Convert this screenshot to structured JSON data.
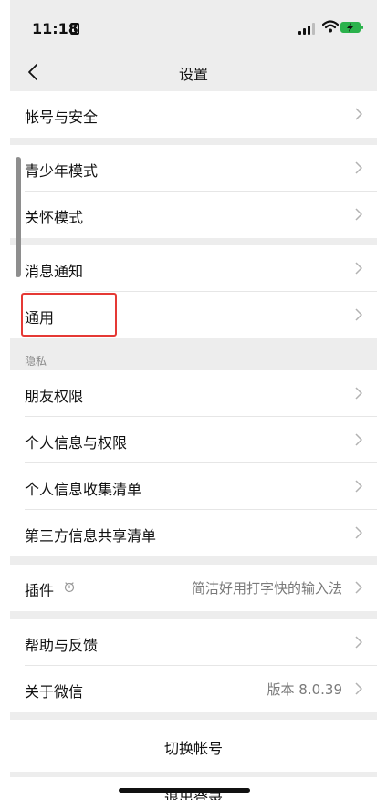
{
  "status_bar": {
    "time": "11:18"
  },
  "nav": {
    "title": "设置"
  },
  "groups": {
    "account": {
      "items": [
        {
          "label": "帐号与安全"
        }
      ]
    },
    "modes": {
      "items": [
        {
          "label": "青少年模式"
        },
        {
          "label": "关怀模式"
        }
      ]
    },
    "notifications": {
      "items": [
        {
          "label": "消息通知"
        },
        {
          "label": "通用"
        }
      ]
    },
    "privacy": {
      "header": "隐私",
      "items": [
        {
          "label": "朋友权限"
        },
        {
          "label": "个人信息与权限"
        },
        {
          "label": "个人信息收集清单"
        },
        {
          "label": "第三方信息共享清单"
        }
      ]
    },
    "plugins": {
      "items": [
        {
          "label": "插件",
          "value": "简洁好用打字快的输入法"
        }
      ]
    },
    "help": {
      "items": [
        {
          "label": "帮助与反馈"
        },
        {
          "label": "关于微信",
          "value": "版本 8.0.39"
        }
      ]
    }
  },
  "actions": {
    "switch_account": "切换帐号",
    "logout": "退出登录"
  },
  "colors": {
    "background": "#ededed",
    "highlight": "#e53935",
    "battery": "#2bb24c"
  }
}
